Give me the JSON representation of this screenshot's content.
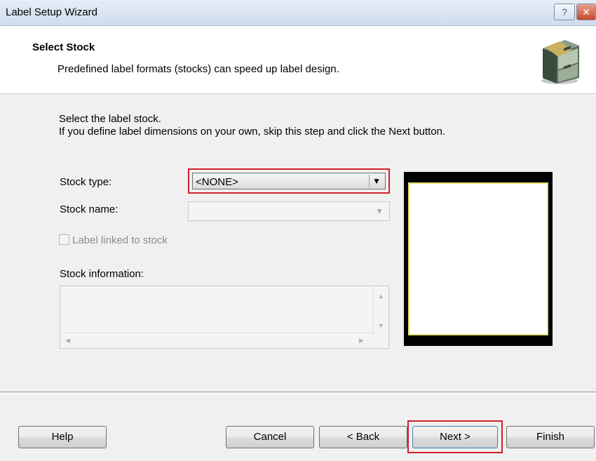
{
  "window": {
    "title": "Label Setup Wizard",
    "help_glyph": "?",
    "close_glyph": "✕"
  },
  "header": {
    "title": "Select Stock",
    "subtitle": "Predefined label formats (stocks) can speed up label design.",
    "icon": "file-cabinet-icon"
  },
  "body": {
    "intro_line1": "Select the label stock.",
    "intro_line2": "If you define label dimensions on your own, skip this step and click the Next button.",
    "stock_type_label": "Stock type:",
    "stock_type_value": "<NONE>",
    "stock_name_label": "Stock name:",
    "stock_name_value": "",
    "label_linked_label": "Label linked to stock",
    "label_linked_checked": false,
    "stock_info_label": "Stock information:",
    "stock_info_value": ""
  },
  "buttons": {
    "help": "Help",
    "cancel": "Cancel",
    "back": "< Back",
    "next": "Next >",
    "finish": "Finish"
  },
  "colors": {
    "highlight": "#d0202a",
    "preview_bg": "#000000",
    "preview_border": "#e8e070"
  }
}
